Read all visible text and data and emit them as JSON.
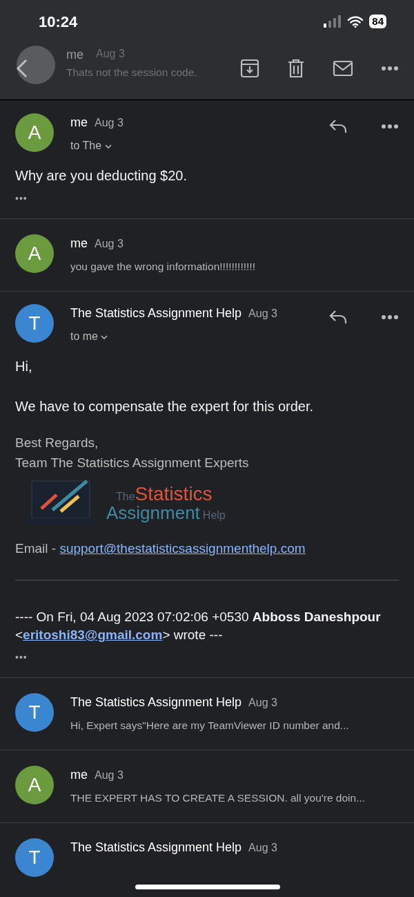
{
  "status_bar": {
    "time": "10:24",
    "battery": "84"
  },
  "toolbar": {
    "behind_sender": "me",
    "behind_date": "Aug 3",
    "behind_snippet": "Thats not the session code."
  },
  "messages": [
    {
      "kind": "expanded",
      "avatar": "A",
      "color": "#6c9a3f",
      "sender": "me",
      "date": "Aug 3",
      "recipient": "to The",
      "body": [
        "Why are you deducting $20."
      ],
      "more": "•••"
    },
    {
      "kind": "collapsed",
      "avatar": "A",
      "color": "#6c9a3f",
      "sender": "me",
      "date": "Aug 3",
      "snippet": "you gave the wrong information!!!!!!!!!!!!"
    },
    {
      "kind": "expanded",
      "avatar": "T",
      "color": "#3b86d1",
      "sender": "The Statistics Assignment Help",
      "date": "Aug 3",
      "recipient": "to me",
      "body": [
        "Hi,",
        "We have to compensate the expert for this order."
      ],
      "signature": [
        "Best Regards,",
        "Team The Statistics Assignment Experts"
      ],
      "logo": {
        "the": "The",
        "statistics": "Statistics",
        "assignment": "Assignment",
        "help": "Help"
      },
      "email_label": "Email - ",
      "email_link": "support@thestatisticsassignmenthelp.com",
      "quote_prefix": "---- On Fri, 04 Aug 2023 07:02:06 +0530 **Abboss Daneshpour** <",
      "quote_link": "eritoshi83@gmail.com",
      "quote_suffix": "> wrote ---",
      "more": "•••"
    },
    {
      "kind": "collapsed",
      "avatar": "T",
      "color": "#3b86d1",
      "sender": "The Statistics Assignment Help",
      "date": "Aug 3",
      "snippet": "Hi, Expert says\"Here are my TeamViewer ID number and..."
    },
    {
      "kind": "collapsed",
      "avatar": "A",
      "color": "#6c9a3f",
      "sender": "me",
      "date": "Aug 3",
      "snippet": "THE EXPERT HAS TO CREATE A SESSION. all you're doin..."
    },
    {
      "kind": "partial",
      "avatar": "T",
      "color": "#3b86d1",
      "sender": "The Statistics Assignment Help",
      "date": "Aug 3"
    }
  ]
}
